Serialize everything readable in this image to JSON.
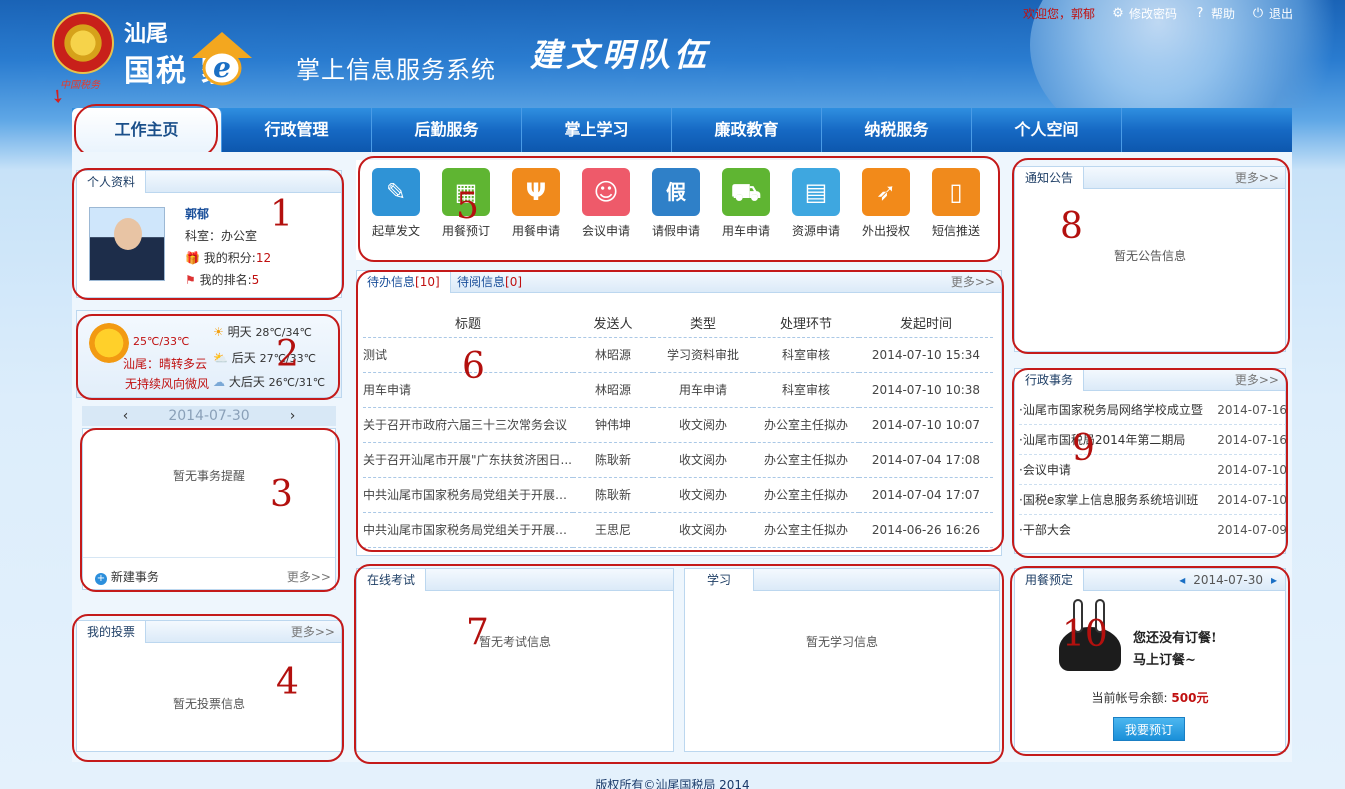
{
  "header": {
    "city": "汕尾",
    "main_logo": "国税 家",
    "logo_e": "e",
    "system_name": "掌上信息服务系统",
    "slogan": "建文明队伍",
    "emblem_text": "中国税务",
    "welcome": "欢迎您，郭郁",
    "links": [
      {
        "label": "修改密码",
        "icon": "gear-icon"
      },
      {
        "label": "帮助",
        "icon": "help-icon"
      },
      {
        "label": "退出",
        "icon": "power-icon"
      }
    ]
  },
  "nav": [
    "工作主页",
    "行政管理",
    "后勤服务",
    "掌上学习",
    "廉政教育",
    "纳税服务",
    "个人空间"
  ],
  "profile": {
    "tab": "个人资料",
    "name": "郭郁",
    "dept": "科室：办公室",
    "points_label": "我的积分:",
    "points": "12",
    "rank_label": "我的排名:",
    "rank": "5"
  },
  "weather": {
    "today_temp": "25℃/33℃",
    "today_desc": "汕尾：晴转多云",
    "today_wind": "无持续风向微风",
    "days": [
      {
        "label": "明天",
        "temp": "28℃/34℃"
      },
      {
        "label": "后天",
        "temp": "27℃/33℃"
      },
      {
        "label": "大后天",
        "temp": "26℃/31℃"
      }
    ]
  },
  "calendar": {
    "date": "2014-07-30",
    "prev": "‹",
    "next": "›"
  },
  "tasks": {
    "empty": "暂无事务提醒",
    "new_label": "新建事务",
    "more": "更多>>"
  },
  "votes": {
    "tab": "我的投票",
    "more": "更多>>",
    "empty": "暂无投票信息"
  },
  "quick": [
    {
      "label": "起草发文",
      "color": "#2f93d6",
      "glyph": "✎"
    },
    {
      "label": "用餐预订",
      "color": "#5fb532",
      "glyph": "▦"
    },
    {
      "label": "用餐申请",
      "color": "#f08a1c",
      "glyph": "Ψ"
    },
    {
      "label": "会议申请",
      "color": "#ee5a6a",
      "glyph": "☺"
    },
    {
      "label": "请假申请",
      "color": "#2f80c8",
      "glyph": "假"
    },
    {
      "label": "用车申请",
      "color": "#5fb532",
      "glyph": "⛟"
    },
    {
      "label": "资源申请",
      "color": "#3ea7e0",
      "glyph": "▤"
    },
    {
      "label": "外出授权",
      "color": "#f28a1a",
      "glyph": "➶"
    },
    {
      "label": "短信推送",
      "color": "#f08a1c",
      "glyph": "▯"
    }
  ],
  "todo": {
    "tabs": [
      {
        "label": "待办信息",
        "count": "[10]"
      },
      {
        "label": "待阅信息",
        "count": "[0]"
      }
    ],
    "more": "更多>>",
    "columns": [
      "标题",
      "发送人",
      "类型",
      "处理环节",
      "发起时间"
    ],
    "rows": [
      [
        "测试",
        "林昭源",
        "学习资料审批",
        "科室审核",
        "2014-07-10 15:34"
      ],
      [
        "用车申请",
        "林昭源",
        "用车申请",
        "科室审核",
        "2014-07-10 10:38"
      ],
      [
        "关于召开市政府六届三十三次常务会议",
        "钟伟坤",
        "收文阅办",
        "办公室主任拟办",
        "2014-07-10 10:07"
      ],
      [
        "关于召开汕尾市开展\"广东扶贫济困日...",
        "陈耿新",
        "收文阅办",
        "办公室主任拟办",
        "2014-07-04 17:08"
      ],
      [
        "中共汕尾市国家税务局党组关于开展培...",
        "陈耿新",
        "收文阅办",
        "办公室主任拟办",
        "2014-07-04 17:07"
      ],
      [
        "中共汕尾市国家税务局党组关于开展培...",
        "王思尼",
        "收文阅办",
        "办公室主任拟办",
        "2014-06-26 16:26"
      ]
    ]
  },
  "exam": {
    "tab": "在线考试",
    "empty": "暂无考试信息"
  },
  "study": {
    "tab": "学习",
    "empty": "暂无学习信息"
  },
  "notice": {
    "tab": "通知公告",
    "more": "更多>>",
    "empty": "暂无公告信息"
  },
  "admin": {
    "tab": "行政事务",
    "more": "更多>>",
    "items": [
      {
        "title": "·汕尾市国家税务局网络学校成立暨",
        "date": "2014-07-16"
      },
      {
        "title": "·汕尾市国税局2014年第二期局",
        "date": "2014-07-16"
      },
      {
        "title": "·会议申请",
        "date": "2014-07-10"
      },
      {
        "title": "·国税e家掌上信息服务系统培训班",
        "date": "2014-07-10"
      },
      {
        "title": "·干部大会",
        "date": "2014-07-09"
      }
    ]
  },
  "meal": {
    "tab": "用餐预定",
    "date": "2014-07-30",
    "prev": "◂",
    "next": "▸",
    "slogan1": "您还没有订餐!",
    "slogan2": "马上订餐~",
    "balance_label": "当前帐号余额:",
    "balance": "500元",
    "button": "我要预订"
  },
  "annotations": [
    "1",
    "2",
    "3",
    "4",
    "5",
    "6",
    "7",
    "8",
    "9",
    "10"
  ],
  "footer": "版权所有©汕尾国税局 2014"
}
